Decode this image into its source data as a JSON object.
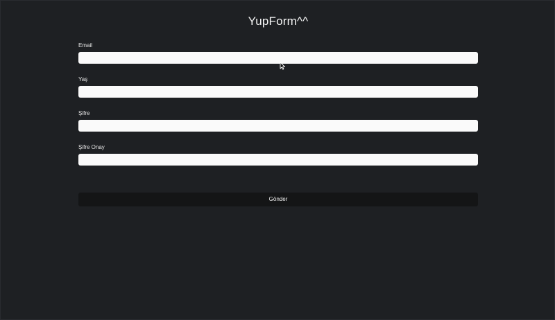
{
  "app": {
    "title": "YupForm^^"
  },
  "form": {
    "fields": [
      {
        "label": "Email",
        "value": "",
        "placeholder": ""
      },
      {
        "label": "Yaş",
        "value": "",
        "placeholder": ""
      },
      {
        "label": "Şifre",
        "value": "",
        "placeholder": ""
      },
      {
        "label": "Şifre Onay",
        "value": "",
        "placeholder": ""
      }
    ],
    "submit_label": "Gönder"
  },
  "colors": {
    "background": "#1e2023",
    "input_background": "#fafafa",
    "button_background": "#141516",
    "text": "#f4f4f4"
  },
  "icons": {
    "cursor": "mouse-pointer-icon"
  }
}
